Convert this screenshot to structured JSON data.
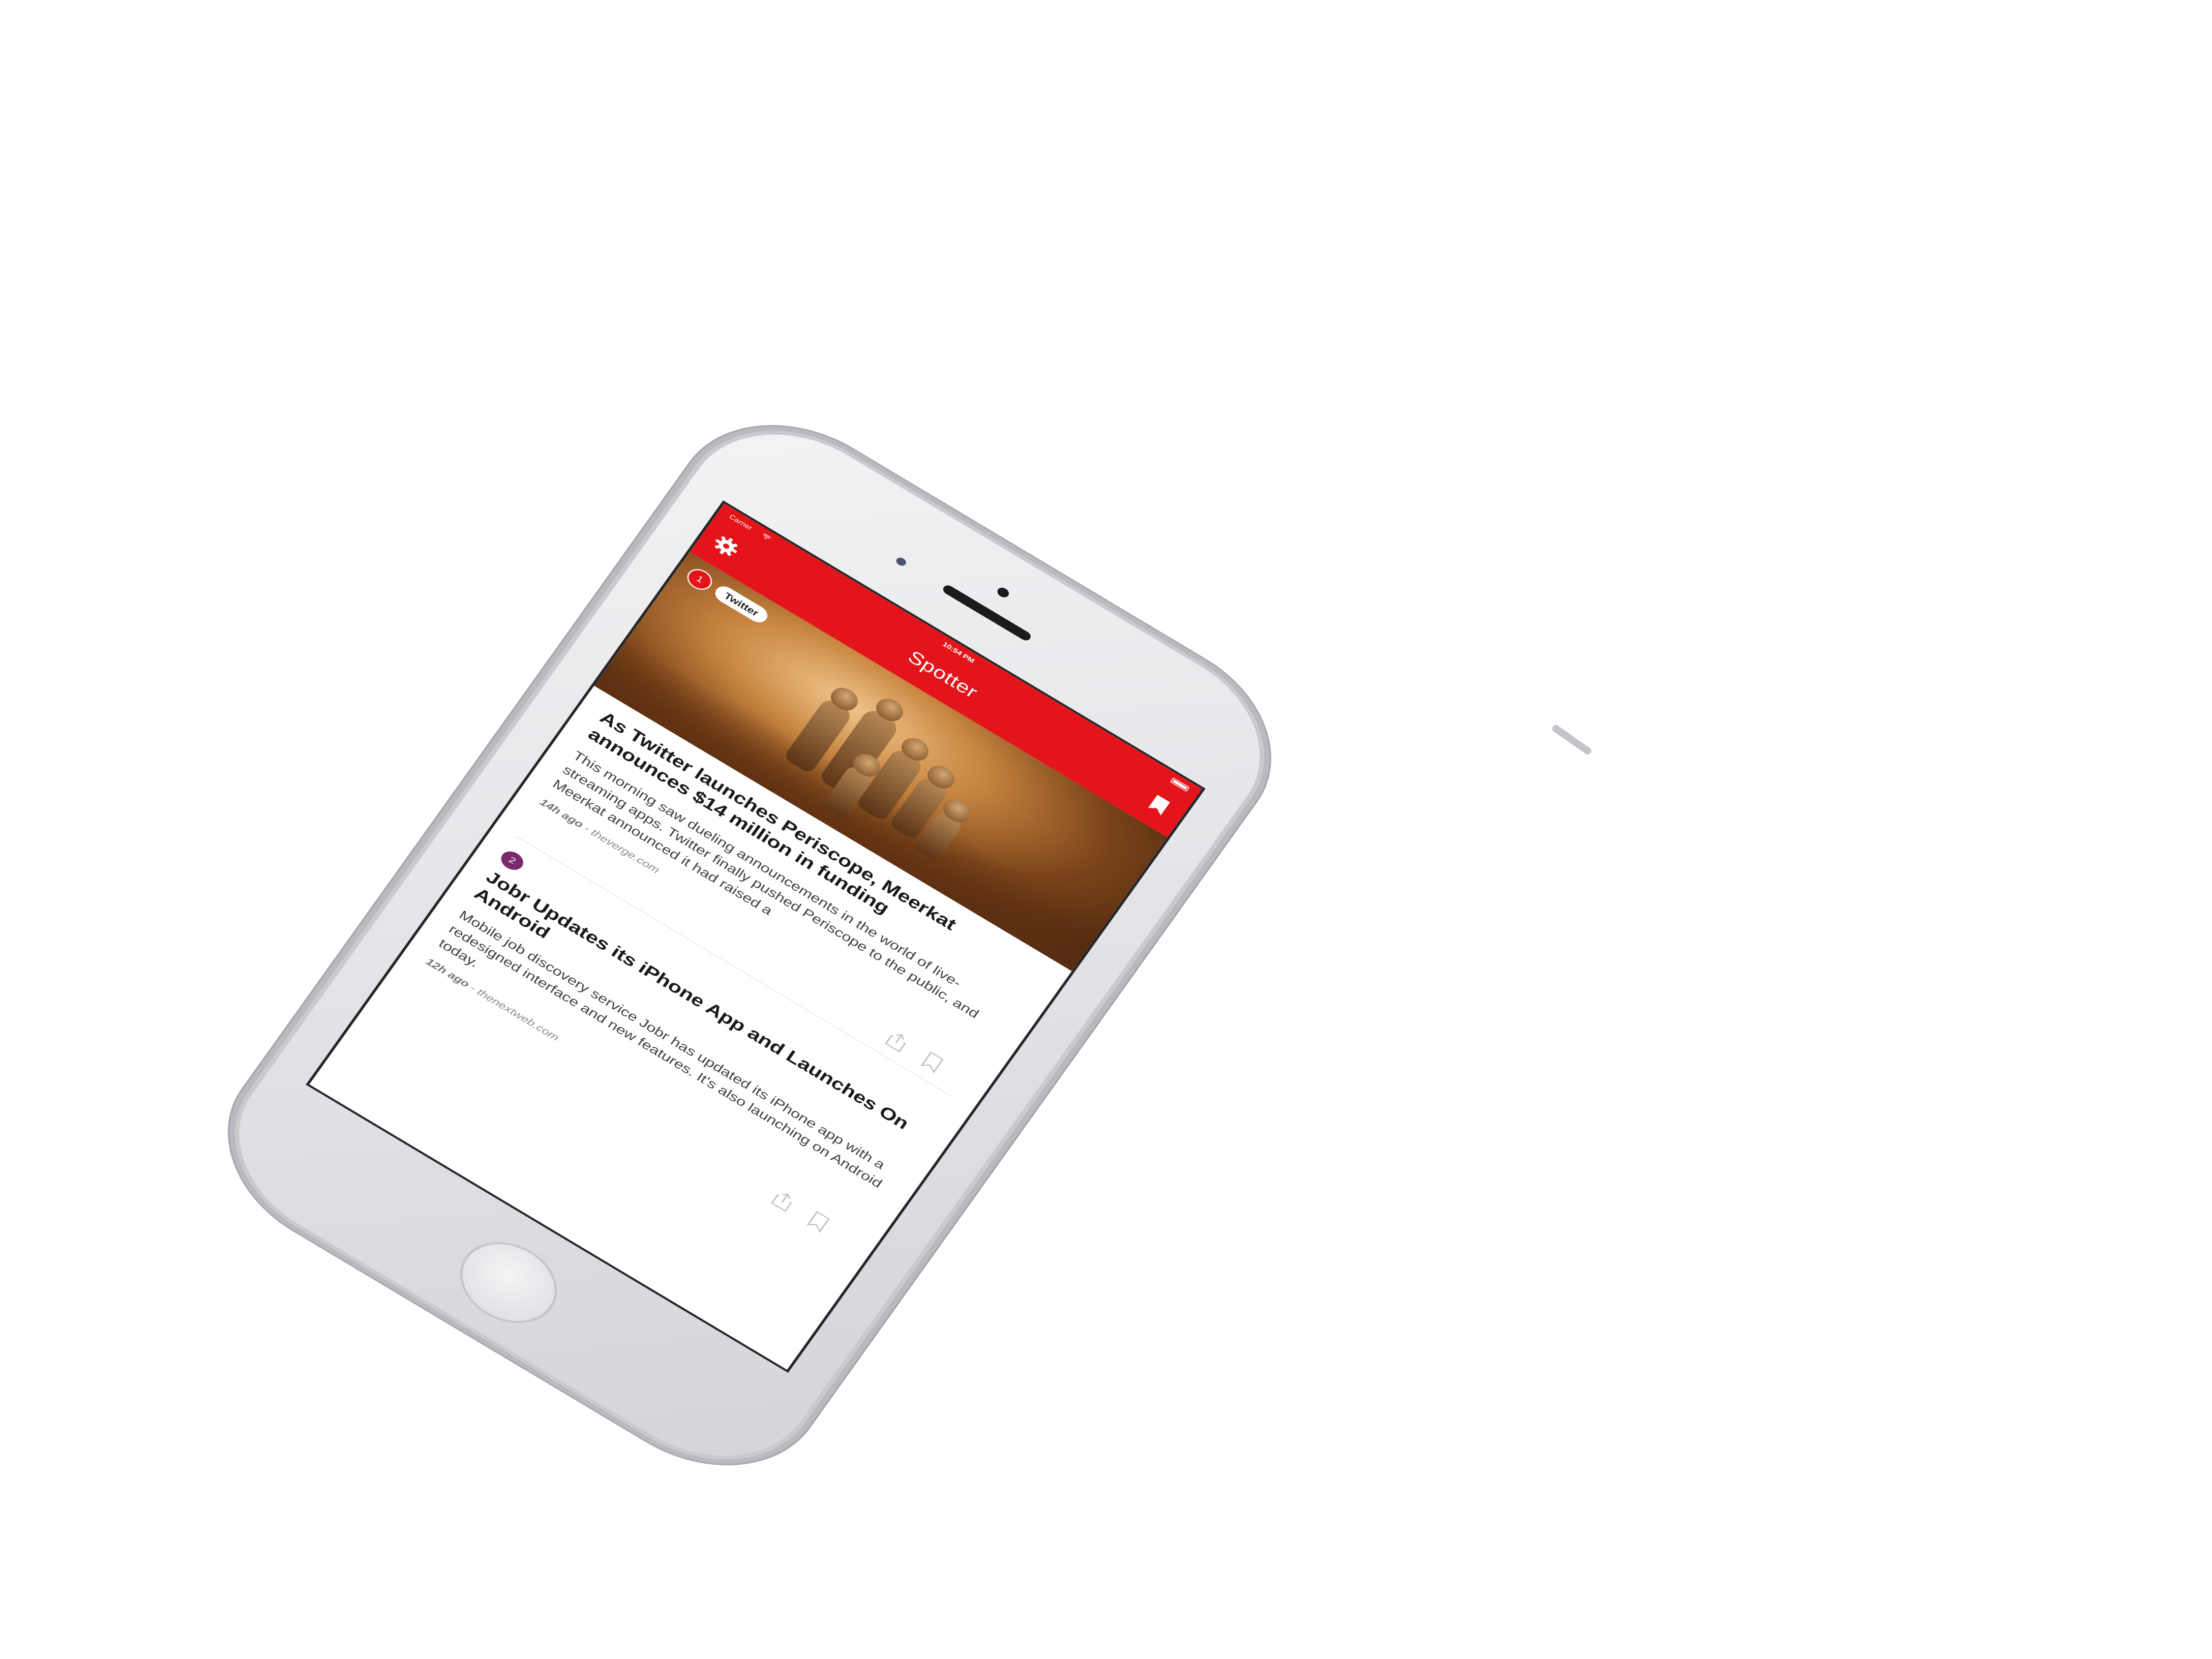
{
  "status_bar": {
    "carrier": "Carrier",
    "time": "10:54 PM"
  },
  "nav": {
    "title": "Spotter",
    "settings_icon": "gear-icon",
    "bookmarks_icon": "bookmark-icon"
  },
  "articles": [
    {
      "rank": "1",
      "topic": "Twitter",
      "title": "As Twitter launches Periscope, Meerkat announces $14 million in funding",
      "summary": "This morning saw dueling announcements in the world of live-streaming apps. Twitter finally pushed Periscope to the public, and Meerkat announced it had raised a",
      "age": "14h ago",
      "source": "theverge.com"
    },
    {
      "rank": "2",
      "title": "Jobr Updates its iPhone App and Launches On Android",
      "summary": "Mobile job discovery service Jobr has updated its iPhone app with a redesigned interface and new features. It's also launching on Android today.",
      "age": "12h ago",
      "source": "thenextweb.com"
    }
  ],
  "theme": {
    "accent": "#e3151b",
    "badge_2": "#7a2a6c",
    "device": "#e4e5e8"
  }
}
